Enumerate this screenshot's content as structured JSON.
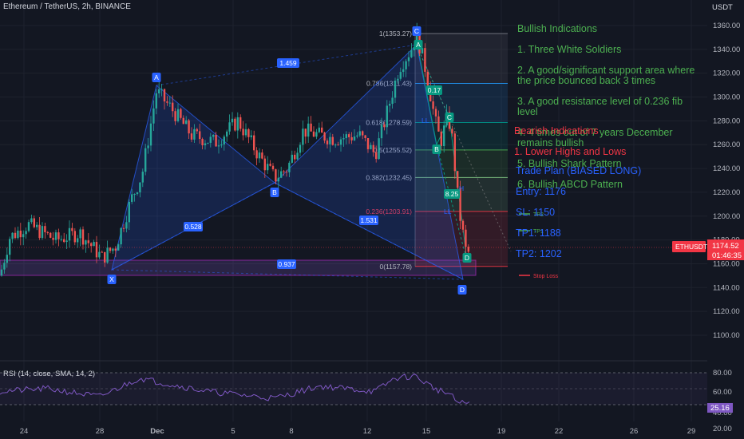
{
  "header": {
    "symbol_title": "Ethereum / TetherUS, 2h, BINANCE",
    "currency": "USDT"
  },
  "price_axis": {
    "ticks": [
      "1360.00",
      "1340.00",
      "1320.00",
      "1300.00",
      "1280.00",
      "1260.00",
      "1240.00",
      "1220.00",
      "1200.00",
      "1180.00",
      "1160.00",
      "1140.00",
      "1120.00",
      "1100.00"
    ],
    "ticker_label": "ETHUSDT",
    "last_price": "1174.52",
    "countdown": "01:46:35",
    "colors": {
      "ticker_bg": "#f23645"
    }
  },
  "time_axis": {
    "labels": [
      "24",
      "28",
      "Dec",
      "5",
      "8",
      "12",
      "15",
      "19",
      "22",
      "26",
      "29"
    ]
  },
  "rsi": {
    "title": "RSI (14, close, SMA, 14, 2)",
    "ticks": [
      "80.00",
      "60.00",
      "40.00",
      "20.00"
    ],
    "value": "25.16"
  },
  "annotations": {
    "bullish_title": "Bullish Indications",
    "bullish_lines": [
      "1. Three White Soldiers",
      "2. A good/significant support area where the price bounced back 3 times",
      "3. A good resistance level of 0.236 fib level",
      "4. 4 times out of 7 years December remains bullish",
      "5. Bullish Shark Pattern",
      "6. Bullish ABCD Pattern"
    ],
    "bearish_title": "Bearish Indications",
    "bearish_lines": [
      "1. Lower Highs and Lows"
    ],
    "plan_title": "Trade Plan (BIASED LONG)",
    "plan_lines": [
      "Entry: 1176",
      "SL: 1150",
      "TP1: 1188",
      "TP2: 1202"
    ]
  },
  "pattern_labels": {
    "X": "X",
    "A": "A",
    "B": "B",
    "C": "C",
    "D": "D",
    "ratio_xa_bc": "1.459",
    "ratio_ab": "0.528",
    "ratio_bc_d": "1.531",
    "ratio_xd": "0.937",
    "abcd_ratio_1": "0.17",
    "abcd_ratio_2": "8.25",
    "ll1": "LL",
    "ll2": "LL",
    "h1": "H"
  },
  "fib_levels": [
    {
      "ratio": "1",
      "label": "1(1353.27)",
      "price": 1353.27
    },
    {
      "ratio": "0.786",
      "label": "0.786(1311.43)",
      "price": 1311.43
    },
    {
      "ratio": "0.618",
      "label": "0.618(1278.59)",
      "price": 1278.59
    },
    {
      "ratio": "0.5",
      "label": "0.5(1255.52)",
      "price": 1255.52
    },
    {
      "ratio": "0.382",
      "label": "0.382(1232.45)",
      "price": 1232.45
    },
    {
      "ratio": "0.236",
      "label": "0.236(1203.91)",
      "price": 1203.91
    },
    {
      "ratio": "0",
      "label": "0(1157.78)",
      "price": 1157.78
    }
  ],
  "trade_lines": {
    "tp2": {
      "label": "TP2",
      "price": 1202
    },
    "tp1": {
      "label": "TP1",
      "price": 1188
    },
    "sl": {
      "label": "Stop Loss",
      "price": 1150
    }
  },
  "colors": {
    "background": "#131722",
    "up": "#26a69a",
    "down": "#ef5350",
    "pattern_blue": "#2962ff",
    "abcd_teal": "#089981",
    "rsi_line": "#7e57c2",
    "bullish_text": "#4caf50",
    "bearish_text": "#f23645",
    "plan_text": "#2962ff"
  }
}
